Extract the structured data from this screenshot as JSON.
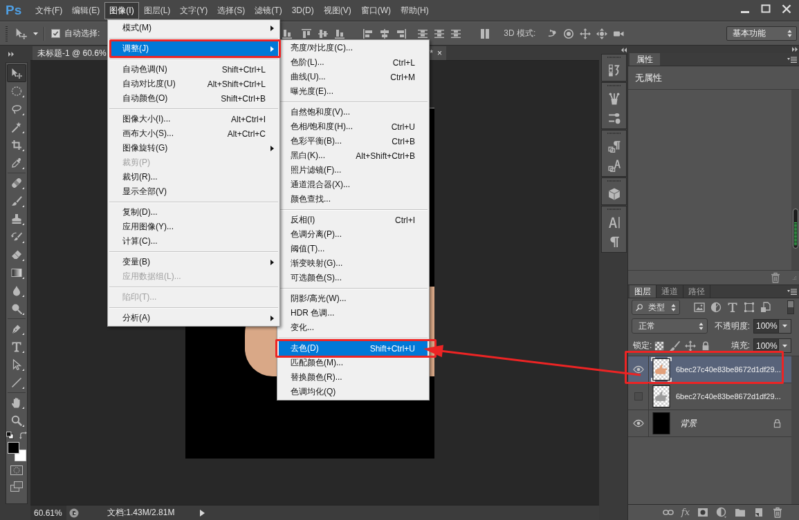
{
  "menubar": {
    "logo": "Ps",
    "items": [
      {
        "label": "文件(F)",
        "selected": false
      },
      {
        "label": "编辑(E)",
        "selected": false
      },
      {
        "label": "图像(I)",
        "selected": true
      },
      {
        "label": "图层(L)",
        "selected": false
      },
      {
        "label": "文字(Y)",
        "selected": false
      },
      {
        "label": "选择(S)",
        "selected": false
      },
      {
        "label": "滤镜(T)",
        "selected": false
      },
      {
        "label": "3D(D)",
        "selected": false
      },
      {
        "label": "视图(V)",
        "selected": false
      },
      {
        "label": "窗口(W)",
        "selected": false
      },
      {
        "label": "帮助(H)",
        "selected": false
      }
    ]
  },
  "options_bar": {
    "auto_select": {
      "label": "自动选择:",
      "checked": true
    },
    "mode_3d_label": "3D 模式:",
    "workspace": "基本功能"
  },
  "toolbox": {
    "tools": [
      {
        "kind": "move",
        "selected": true
      },
      {
        "kind": "marquee",
        "selected": false
      },
      {
        "kind": "lasso",
        "selected": false
      },
      {
        "kind": "magic-wand",
        "selected": false
      },
      {
        "kind": "crop",
        "selected": false
      },
      {
        "kind": "eyedropper",
        "selected": false
      },
      {
        "kind": "separator"
      },
      {
        "kind": "healing",
        "selected": false
      },
      {
        "kind": "brush",
        "selected": false
      },
      {
        "kind": "stamp",
        "selected": false
      },
      {
        "kind": "history-brush",
        "selected": false
      },
      {
        "kind": "eraser",
        "selected": false
      },
      {
        "kind": "gradient",
        "selected": false
      },
      {
        "kind": "blur",
        "selected": false
      },
      {
        "kind": "dodge",
        "selected": false
      },
      {
        "kind": "separator"
      },
      {
        "kind": "pen",
        "selected": false
      },
      {
        "kind": "type",
        "selected": false
      },
      {
        "kind": "path-select",
        "selected": false
      },
      {
        "kind": "line",
        "selected": false
      },
      {
        "kind": "separator"
      },
      {
        "kind": "hand",
        "selected": false
      },
      {
        "kind": "zoom",
        "selected": false
      }
    ],
    "swatches": [
      {
        "kind": "foreground",
        "color": "#000000"
      },
      {
        "kind": "background",
        "color": "#ffffff"
      }
    ]
  },
  "document": {
    "tab_title": "未标题-1 @ 60.6%",
    "tab_title_end": "*",
    "tab_close": "×"
  },
  "status_bar": {
    "zoom": "60.61%",
    "doc_info": "文档:1.43M/2.81M"
  },
  "image_menu": {
    "items": [
      {
        "kind": "item",
        "label": "模式(M)",
        "submenu": true,
        "disabled": false,
        "selected": false,
        "marked": false
      },
      {
        "kind": "separator"
      },
      {
        "kind": "item",
        "label": "调整(J)",
        "submenu": true,
        "disabled": false,
        "selected": true,
        "marked": true
      },
      {
        "kind": "separator"
      },
      {
        "kind": "item",
        "label": "自动色调(N)",
        "shortcut": "Shift+Ctrl+L",
        "submenu": false,
        "disabled": false,
        "selected": false,
        "marked": false
      },
      {
        "kind": "item",
        "label": "自动对比度(U)",
        "shortcut": "Alt+Shift+Ctrl+L",
        "submenu": false,
        "disabled": false,
        "selected": false,
        "marked": false
      },
      {
        "kind": "item",
        "label": "自动颜色(O)",
        "shortcut": "Shift+Ctrl+B",
        "submenu": false,
        "disabled": false,
        "selected": false,
        "marked": false
      },
      {
        "kind": "separator"
      },
      {
        "kind": "item",
        "label": "图像大小(I)...",
        "shortcut": "Alt+Ctrl+I",
        "submenu": false,
        "disabled": false,
        "selected": false,
        "marked": false
      },
      {
        "kind": "item",
        "label": "画布大小(S)...",
        "shortcut": "Alt+Ctrl+C",
        "submenu": false,
        "disabled": false,
        "selected": false,
        "marked": false
      },
      {
        "kind": "item",
        "label": "图像旋转(G)",
        "submenu": true,
        "disabled": false,
        "selected": false,
        "marked": false
      },
      {
        "kind": "item",
        "label": "裁剪(P)",
        "submenu": false,
        "disabled": true,
        "selected": false,
        "marked": false
      },
      {
        "kind": "item",
        "label": "裁切(R)...",
        "submenu": false,
        "disabled": false,
        "selected": false,
        "marked": false
      },
      {
        "kind": "item",
        "label": "显示全部(V)",
        "submenu": false,
        "disabled": false,
        "selected": false,
        "marked": false
      },
      {
        "kind": "separator"
      },
      {
        "kind": "item",
        "label": "复制(D)...",
        "submenu": false,
        "disabled": false,
        "selected": false,
        "marked": false
      },
      {
        "kind": "item",
        "label": "应用图像(Y)...",
        "submenu": false,
        "disabled": false,
        "selected": false,
        "marked": false
      },
      {
        "kind": "item",
        "label": "计算(C)...",
        "submenu": false,
        "disabled": false,
        "selected": false,
        "marked": false
      },
      {
        "kind": "separator"
      },
      {
        "kind": "item",
        "label": "变量(B)",
        "submenu": true,
        "disabled": false,
        "selected": false,
        "marked": false
      },
      {
        "kind": "item",
        "label": "应用数据组(L)...",
        "submenu": false,
        "disabled": true,
        "selected": false,
        "marked": false
      },
      {
        "kind": "separator"
      },
      {
        "kind": "item",
        "label": "陷印(T)...",
        "submenu": false,
        "disabled": true,
        "selected": false,
        "marked": false
      },
      {
        "kind": "separator"
      },
      {
        "kind": "item",
        "label": "分析(A)",
        "submenu": true,
        "disabled": false,
        "selected": false,
        "marked": false
      }
    ]
  },
  "adjust_submenu": {
    "items": [
      {
        "kind": "item",
        "label": "亮度/对比度(C)...",
        "submenu": false,
        "disabled": false,
        "selected": false,
        "marked": false
      },
      {
        "kind": "item",
        "label": "色阶(L)...",
        "shortcut": "Ctrl+L",
        "submenu": false,
        "disabled": false,
        "selected": false,
        "marked": false
      },
      {
        "kind": "item",
        "label": "曲线(U)...",
        "shortcut": "Ctrl+M",
        "submenu": false,
        "disabled": false,
        "selected": false,
        "marked": false
      },
      {
        "kind": "item",
        "label": "曝光度(E)...",
        "submenu": false,
        "disabled": false,
        "selected": false,
        "marked": false
      },
      {
        "kind": "separator"
      },
      {
        "kind": "item",
        "label": "自然饱和度(V)...",
        "submenu": false,
        "disabled": false,
        "selected": false,
        "marked": false
      },
      {
        "kind": "item",
        "label": "色相/饱和度(H)...",
        "shortcut": "Ctrl+U",
        "submenu": false,
        "disabled": false,
        "selected": false,
        "marked": false
      },
      {
        "kind": "item",
        "label": "色彩平衡(B)...",
        "shortcut": "Ctrl+B",
        "submenu": false,
        "disabled": false,
        "selected": false,
        "marked": false
      },
      {
        "kind": "item",
        "label": "黑白(K)...",
        "shortcut": "Alt+Shift+Ctrl+B",
        "submenu": false,
        "disabled": false,
        "selected": false,
        "marked": false
      },
      {
        "kind": "item",
        "label": "照片滤镜(F)...",
        "submenu": false,
        "disabled": false,
        "selected": false,
        "marked": false
      },
      {
        "kind": "item",
        "label": "通道混合器(X)...",
        "submenu": false,
        "disabled": false,
        "selected": false,
        "marked": false
      },
      {
        "kind": "item",
        "label": "颜色查找...",
        "submenu": false,
        "disabled": false,
        "selected": false,
        "marked": false
      },
      {
        "kind": "separator"
      },
      {
        "kind": "item",
        "label": "反相(I)",
        "shortcut": "Ctrl+I",
        "submenu": false,
        "disabled": false,
        "selected": false,
        "marked": false
      },
      {
        "kind": "item",
        "label": "色调分离(P)...",
        "submenu": false,
        "disabled": false,
        "selected": false,
        "marked": false
      },
      {
        "kind": "item",
        "label": "阈值(T)...",
        "submenu": false,
        "disabled": false,
        "selected": false,
        "marked": false
      },
      {
        "kind": "item",
        "label": "渐变映射(G)...",
        "submenu": false,
        "disabled": false,
        "selected": false,
        "marked": false
      },
      {
        "kind": "item",
        "label": "可选颜色(S)...",
        "submenu": false,
        "disabled": false,
        "selected": false,
        "marked": false
      },
      {
        "kind": "separator"
      },
      {
        "kind": "item",
        "label": "阴影/高光(W)...",
        "submenu": false,
        "disabled": false,
        "selected": false,
        "marked": false
      },
      {
        "kind": "item",
        "label": "HDR 色调...",
        "submenu": false,
        "disabled": false,
        "selected": false,
        "marked": false
      },
      {
        "kind": "item",
        "label": "变化...",
        "submenu": false,
        "disabled": false,
        "selected": false,
        "marked": false
      },
      {
        "kind": "separator"
      },
      {
        "kind": "item",
        "label": "去色(D)",
        "shortcut": "Shift+Ctrl+U",
        "submenu": false,
        "disabled": false,
        "selected": true,
        "marked": true
      },
      {
        "kind": "item",
        "label": "匹配颜色(M)...",
        "submenu": false,
        "disabled": false,
        "selected": false,
        "marked": false
      },
      {
        "kind": "item",
        "label": "替换颜色(R)...",
        "submenu": false,
        "disabled": false,
        "selected": false,
        "marked": false
      },
      {
        "kind": "item",
        "label": "色调均化(Q)",
        "submenu": false,
        "disabled": false,
        "selected": false,
        "marked": false
      }
    ]
  },
  "properties_panel": {
    "tab": "属性",
    "message": "无属性"
  },
  "layers_panel": {
    "tabs": [
      {
        "label": "图层",
        "selected": true
      },
      {
        "label": "通道",
        "selected": false
      },
      {
        "label": "路径",
        "selected": false
      }
    ],
    "filter": "类型",
    "blend_mode": "正常",
    "opacity": {
      "label": "不透明度:",
      "value": "100%"
    },
    "lock_label": "锁定:",
    "fill": {
      "label": "填充:",
      "value": "100%"
    },
    "layers": [
      {
        "kind": "layer",
        "name": "6bec27c40e83be8672d1df29...",
        "thumbnail": {
          "kind": "color-hand"
        },
        "visible": true,
        "selected": true,
        "locked": false,
        "marked": true
      },
      {
        "kind": "layer",
        "name": "6bec27c40e83be8672d1df29...",
        "thumbnail": {
          "kind": "gray-hand"
        },
        "visible": false,
        "selected": false,
        "locked": false,
        "marked": false
      },
      {
        "kind": "background",
        "name": "背景",
        "thumbnail": {
          "kind": "black"
        },
        "visible": true,
        "selected": false,
        "locked": true,
        "marked": false
      }
    ],
    "effects_button": "fx"
  },
  "callout_arrow": true
}
